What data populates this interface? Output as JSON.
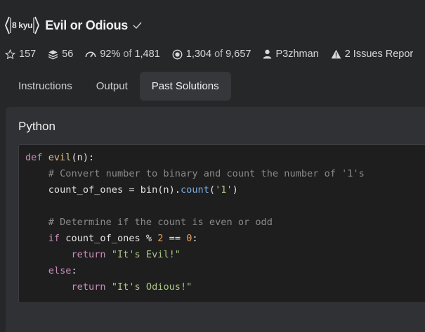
{
  "kata": {
    "rank": "8 kyu",
    "title": "Evil or Odious"
  },
  "stats": {
    "stars": "157",
    "collections": "56",
    "satisfaction": "92%",
    "satisfaction_of_word": "of",
    "votes": "1,481",
    "completed": "1,304",
    "completed_of_word": "of",
    "attempted": "9,657",
    "author": "P3zhman",
    "issues": "2 Issues Repor"
  },
  "tabs": [
    "Instructions",
    "Output",
    "Past Solutions"
  ],
  "active_tab": "Past Solutions",
  "solution": {
    "language": "Python",
    "code_lines": [
      [
        {
          "t": "def ",
          "c": "kw"
        },
        {
          "t": "evil",
          "c": "fn"
        },
        {
          "t": "(n):",
          "c": "pl"
        }
      ],
      [
        {
          "t": "    # Convert number to binary and count the number of '1's",
          "c": "cm"
        }
      ],
      [
        {
          "t": "    count_of_ones ",
          "c": "pl"
        },
        {
          "t": "=",
          "c": "op"
        },
        {
          "t": " bin(n).",
          "c": "pl"
        },
        {
          "t": "count",
          "c": "meth"
        },
        {
          "t": "(",
          "c": "pl"
        },
        {
          "t": "'1'",
          "c": "str"
        },
        {
          "t": ")",
          "c": "pl"
        }
      ],
      [
        {
          "t": "",
          "c": "pl"
        }
      ],
      [
        {
          "t": "    # Determine if the count is even or odd",
          "c": "cm"
        }
      ],
      [
        {
          "t": "    ",
          "c": "pl"
        },
        {
          "t": "if",
          "c": "kw"
        },
        {
          "t": " count_of_ones ",
          "c": "pl"
        },
        {
          "t": "%",
          "c": "op"
        },
        {
          "t": " ",
          "c": "pl"
        },
        {
          "t": "2",
          "c": "num"
        },
        {
          "t": " ",
          "c": "pl"
        },
        {
          "t": "==",
          "c": "op"
        },
        {
          "t": " ",
          "c": "pl"
        },
        {
          "t": "0",
          "c": "num"
        },
        {
          "t": ":",
          "c": "pl"
        }
      ],
      [
        {
          "t": "        ",
          "c": "pl"
        },
        {
          "t": "return",
          "c": "kw"
        },
        {
          "t": " ",
          "c": "pl"
        },
        {
          "t": "\"It's Evil!\"",
          "c": "str"
        }
      ],
      [
        {
          "t": "    ",
          "c": "pl"
        },
        {
          "t": "else",
          "c": "kw"
        },
        {
          "t": ":",
          "c": "pl"
        }
      ],
      [
        {
          "t": "        ",
          "c": "pl"
        },
        {
          "t": "return",
          "c": "kw"
        },
        {
          "t": " ",
          "c": "pl"
        },
        {
          "t": "\"It's Odious!\"",
          "c": "str"
        }
      ]
    ]
  },
  "colors": {
    "background": "#262729",
    "panel": "#303134",
    "code_bg": "#1e1e1f",
    "active_tab": "#35373b",
    "syntax": {
      "kw": "#c98db8",
      "fn": "#e0c07a",
      "pl": "#e2e2e2",
      "cm": "#8a8a8a",
      "op": "#e2e2e2",
      "meth": "#7ba9e0",
      "str": "#a9c785",
      "num": "#e8a061"
    }
  },
  "icons": {
    "rank_badge": "hexagon-badge-icon",
    "verified": "checkmark-icon",
    "stars": "star-icon",
    "collections": "stack-icon",
    "satisfaction": "gauge-icon",
    "completed": "target-icon",
    "author": "user-icon",
    "issues": "warning-icon"
  }
}
